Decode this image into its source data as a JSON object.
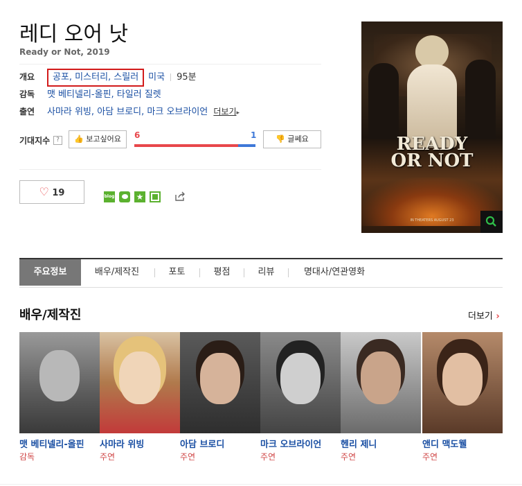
{
  "movie": {
    "title": "레디 오어 낫",
    "subtitle": "Ready or Not, 2019"
  },
  "info": {
    "overview_label": "개요",
    "genres": "공포, 미스터리, 스릴러",
    "country": "미국",
    "runtime": "95분",
    "director_label": "감독",
    "directors": "맷 베티넬리-올핀, 타일러 질렛",
    "cast_label": "출연",
    "cast_line": "사마라 위빙, 아담 브로디, 마크 오브라이언",
    "more_label": "더보기"
  },
  "expect": {
    "label": "기대지수",
    "help": "?",
    "want_label": "보고싶어요",
    "want_count": "6",
    "not_label": "글쎄요",
    "not_count": "1",
    "want_ratio": 0.857
  },
  "like": {
    "count": "19"
  },
  "share_icons": [
    "blog-icon",
    "talk-icon",
    "star-icon",
    "square-icon"
  ],
  "poster": {
    "line1": "READY",
    "line2": "OR NOT",
    "release": "IN THEATERS AUGUST 23"
  },
  "tabs": [
    {
      "label": "주요정보"
    },
    {
      "label": "배우/제작진"
    },
    {
      "label": "포토"
    },
    {
      "label": "평점"
    },
    {
      "label": "리뷰"
    },
    {
      "label": "명대사/연관영화"
    }
  ],
  "cast_section": {
    "title": "배우/제작진",
    "more": "더보기",
    "members": [
      {
        "name": "맷 베티넬리-올핀",
        "role": "감독"
      },
      {
        "name": "사마라 위빙",
        "role": "주연"
      },
      {
        "name": "아담 브로디",
        "role": "주연"
      },
      {
        "name": "마크 오브라이언",
        "role": "주연"
      },
      {
        "name": "헨리 제니",
        "role": "주연"
      },
      {
        "name": "앤디 맥도웰",
        "role": "주연"
      }
    ]
  },
  "colors": {
    "link": "#1a4fa3",
    "highlight": "#d21a1a",
    "want": "#e8474b",
    "not": "#3e78d8",
    "role": "#d04848"
  }
}
